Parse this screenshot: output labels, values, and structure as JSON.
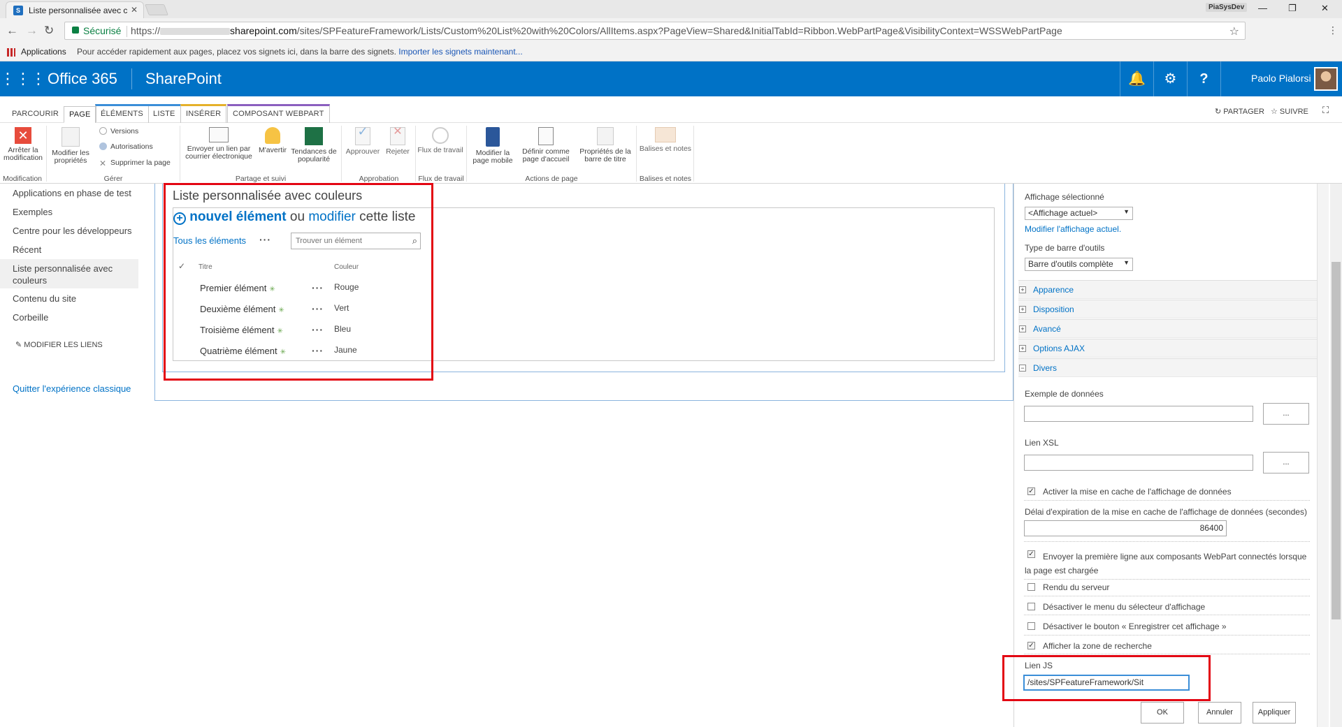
{
  "browser": {
    "tab_title": "Liste personnalisée avec c",
    "profile": "PiaSysDev",
    "secure_label": "Sécurisé",
    "url_prefix": "https://",
    "url_domain": "sharepoint.com",
    "url_rest": "/sites/SPFeatureFramework/Lists/Custom%20List%20with%20Colors/AllItems.aspx?PageView=Shared&InitialTabId=Ribbon.WebPartPage&VisibilityContext=WSSWebPartPage",
    "bookmarks_apps": "Applications",
    "bookmarks_hint": "Pour accéder rapidement aux pages, placez vos signets ici, dans la barre des signets.",
    "bookmarks_import": "Importer les signets maintenant..."
  },
  "suite": {
    "brand": "Office 365",
    "app": "SharePoint",
    "user": "Paolo Pialorsi",
    "accent": "#0072c6"
  },
  "ribbon_tabs": {
    "parcourir": "PARCOURIR",
    "page": "PAGE",
    "elements": "ÉLÉMENTS",
    "liste": "LISTE",
    "inserer": "INSÉRER",
    "composant": "COMPOSANT WEBPART",
    "partager": "PARTAGER",
    "suivre": "SUIVRE"
  },
  "ribbon": {
    "stop_edit": "Arrêter la modification",
    "edit_props": "Modifier les propriétés",
    "versions": "Versions",
    "permissions": "Autorisations",
    "delete_page": "Supprimer la page",
    "email_link": "Envoyer un lien par courrier électronique",
    "alert": "M'avertir",
    "popularity": "Tendances de popularité",
    "approve": "Approuver",
    "reject": "Rejeter",
    "workflow": "Flux de travail",
    "mobile": "Modifier la page mobile",
    "homepage": "Définir comme page d'accueil",
    "title_props": "Propriétés de la barre de titre",
    "tags": "Balises et notes",
    "groups": {
      "modification": "Modification",
      "manage": "Gérer",
      "share": "Partage et suivi",
      "approval": "Approbation",
      "workflow": "Flux de travail",
      "page_actions": "Actions de page",
      "tags": "Balises et notes"
    }
  },
  "quicklaunch": {
    "items": [
      "Applications en phase de test",
      "Exemples",
      "Centre pour les développeurs",
      "Récent",
      "Liste personnalisée avec",
      "couleurs",
      "Contenu du site",
      "Corbeille"
    ],
    "edit_links": "MODIFIER LES LIENS",
    "exit_classic": "Quitter l'expérience classique"
  },
  "list": {
    "title": "Liste personnalisée avec couleurs",
    "new_item": "nouvel élément",
    "or": "ou",
    "edit": "modifier",
    "this_list": "cette liste",
    "all_items": "Tous les éléments",
    "search_placeholder": "Trouver un élément",
    "col_title": "Titre",
    "col_color": "Couleur",
    "rows": [
      {
        "title": "Premier élément",
        "color": "Rouge"
      },
      {
        "title": "Deuxième élément",
        "color": "Vert"
      },
      {
        "title": "Troisième élément",
        "color": "Bleu"
      },
      {
        "title": "Quatrième élément",
        "color": "Jaune"
      }
    ]
  },
  "toolpane": {
    "selected_view_label": "Affichage sélectionné",
    "selected_view": "<Affichage actuel>",
    "edit_view": "Modifier l'affichage actuel.",
    "toolbar_type_label": "Type de barre d'outils",
    "toolbar_type": "Barre d'outils complète",
    "sections": [
      "Apparence",
      "Disposition",
      "Avancé",
      "Options AJAX",
      "Divers"
    ],
    "sample_data": "Exemple de données",
    "xsl_link": "Lien XSL",
    "browse": "...",
    "enable_cache": "Activer la mise en cache de l'affichage de données",
    "cache_timeout_label": "Délai d'expiration de la mise en cache de l'affichage de données (secondes)",
    "cache_timeout": "86400",
    "send_first_row": "Envoyer la première ligne aux composants WebPart connectés lorsque la page est chargée",
    "server_render": "Rendu du serveur",
    "disable_view_menu": "Désactiver le menu du sélecteur d'affichage",
    "disable_save_view": "Désactiver le bouton « Enregistrer cet affichage »",
    "show_search": "Afficher la zone de recherche",
    "js_link_label": "Lien JS",
    "js_link": "/sites/SPFeatureFramework/Sit",
    "ok": "OK",
    "cancel": "Annuler",
    "apply": "Appliquer"
  },
  "highlight_color": "#e30613"
}
